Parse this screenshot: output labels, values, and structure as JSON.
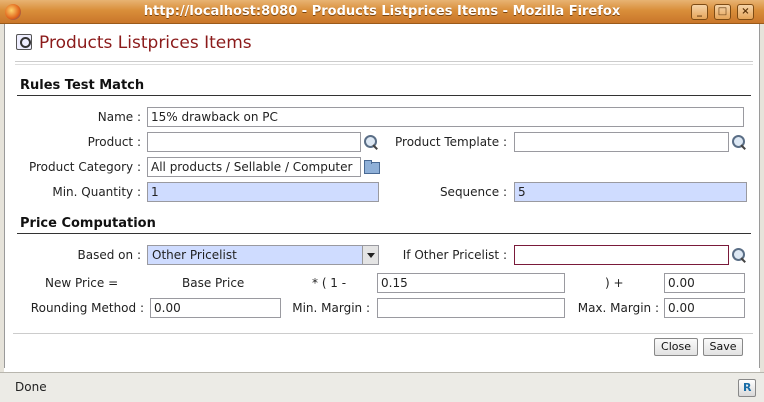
{
  "window": {
    "title": "http://localhost:8080 - Products Listprices Items - Mozilla Firefox",
    "minimize_glyph": "_",
    "maximize_glyph": "□",
    "close_glyph": "×"
  },
  "form": {
    "title": "Products Listprices Items"
  },
  "rules": {
    "section_title": "Rules Test Match",
    "name_label": "Name :",
    "name_value": "15% drawback on PC",
    "product_label": "Product :",
    "product_value": "",
    "product_template_label": "Product Template :",
    "product_template_value": "",
    "product_category_label": "Product Category :",
    "product_category_value": "All products / Sellable / Computer",
    "min_quantity_label": "Min. Quantity :",
    "min_quantity_value": "1",
    "sequence_label": "Sequence :",
    "sequence_value": "5"
  },
  "price": {
    "section_title": "Price Computation",
    "based_on_label": "Based on :",
    "based_on_value": "Other Pricelist",
    "if_other_pricelist_label": "If Other Pricelist :",
    "if_other_pricelist_value": "",
    "new_price_label": "New Price =",
    "base_price_text": "Base Price",
    "times_text": "* ( 1 -",
    "discount_value": "0.15",
    "plus_text": ") +",
    "surcharge_value": "0.00",
    "rounding_label": "Rounding Method :",
    "rounding_value": "0.00",
    "min_margin_label": "Min. Margin :",
    "min_margin_value": "",
    "max_margin_label": "Max. Margin :",
    "max_margin_value": "0.00"
  },
  "buttons": {
    "close": "Close",
    "save": "Save"
  },
  "status": {
    "text": "Done"
  },
  "colors": {
    "title_bar": "#d98e3a",
    "form_title": "#8b1a1a",
    "required_field": "#cfdcff"
  }
}
